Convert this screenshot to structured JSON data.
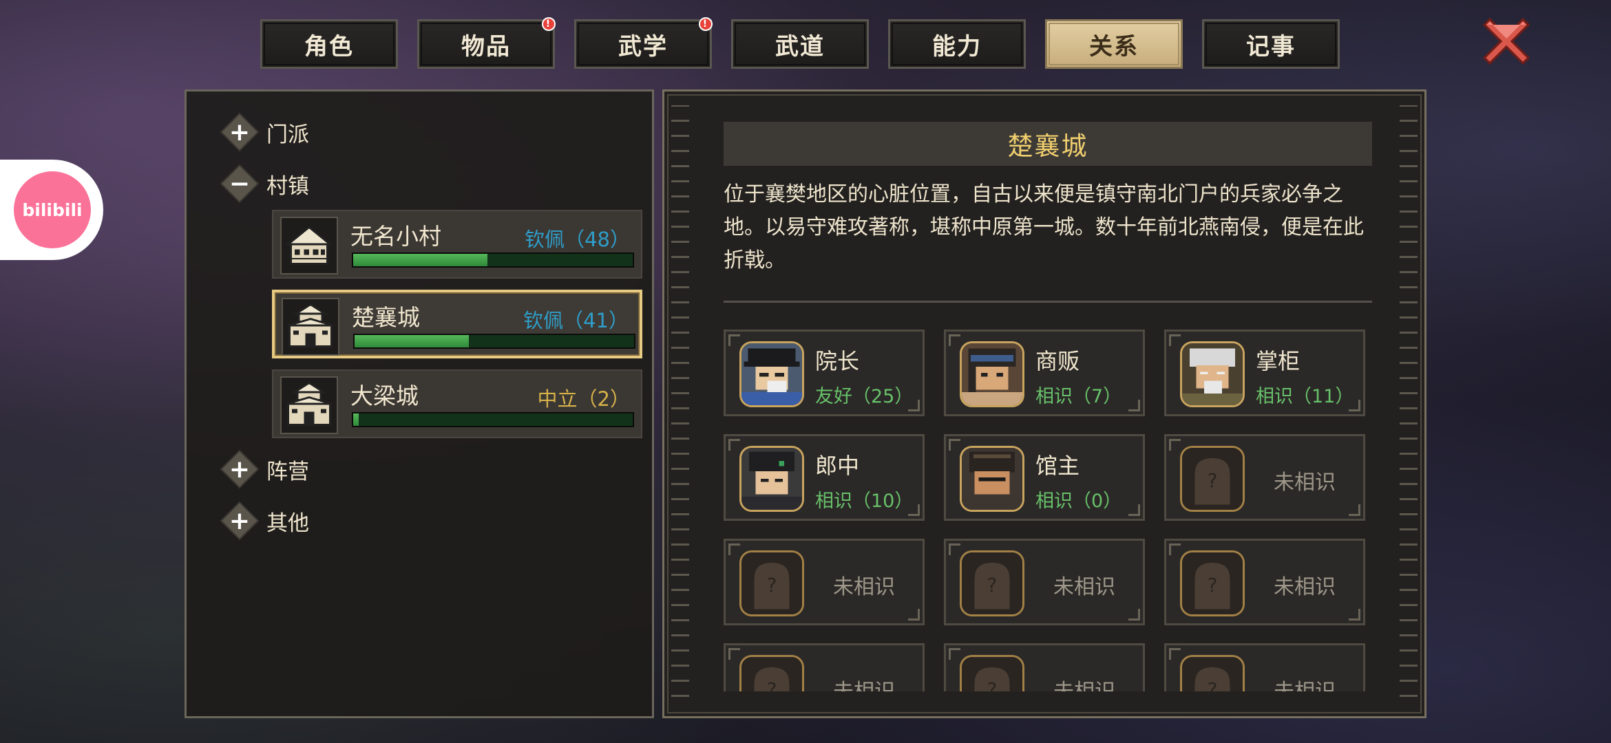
{
  "tabs": [
    {
      "label": "角色",
      "active": false,
      "alert": false
    },
    {
      "label": "物品",
      "active": false,
      "alert": true
    },
    {
      "label": "武学",
      "active": false,
      "alert": true
    },
    {
      "label": "武道",
      "active": false,
      "alert": false
    },
    {
      "label": "能力",
      "active": false,
      "alert": false
    },
    {
      "label": "关系",
      "active": true,
      "alert": false
    },
    {
      "label": "记事",
      "active": false,
      "alert": false
    }
  ],
  "alert_mark": "!",
  "bilibili_logo": "bilibili",
  "tree": {
    "menpai": {
      "label": "门派",
      "symbol": "+"
    },
    "cunzhen": {
      "label": "村镇",
      "symbol": "−"
    },
    "zhenying": {
      "label": "阵营",
      "symbol": "+"
    },
    "qita": {
      "label": "其他",
      "symbol": "+"
    }
  },
  "towns": [
    {
      "name": "无名小村",
      "status": "钦佩（48）",
      "status_color": "#2f9ec9",
      "progress": 0.48,
      "selected": false,
      "icon": "house-icon"
    },
    {
      "name": "楚襄城",
      "status": "钦佩（41）",
      "status_color": "#2f9ec9",
      "progress": 0.41,
      "selected": true,
      "icon": "city-gate-icon"
    },
    {
      "name": "大梁城",
      "status": "中立（2）",
      "status_color": "#d6b24a",
      "progress": 0.02,
      "selected": false,
      "icon": "city-gate-icon"
    }
  ],
  "detail": {
    "title": "楚襄城",
    "description": "位于襄樊地区的心脏位置，自古以来便是镇守南北门户的兵家必争之地。以易守难攻著称，堪称中原第一城。数十年前北燕南侵，便是在此折戟。"
  },
  "npcs": [
    {
      "name": "院长",
      "relation": "友好（25）",
      "known": true,
      "portrait": "dean-portrait"
    },
    {
      "name": "商贩",
      "relation": "相识（7）",
      "known": true,
      "portrait": "merchant-portrait"
    },
    {
      "name": "掌柜",
      "relation": "相识（11）",
      "known": true,
      "portrait": "shopkeeper-portrait"
    },
    {
      "name": "郎中",
      "relation": "相识（10）",
      "known": true,
      "portrait": "doctor-portrait"
    },
    {
      "name": "馆主",
      "relation": "相识（0）",
      "known": true,
      "portrait": "hall-master-portrait"
    },
    {
      "name": "",
      "relation": "未相识",
      "known": false
    },
    {
      "name": "",
      "relation": "未相识",
      "known": false
    },
    {
      "name": "",
      "relation": "未相识",
      "known": false
    },
    {
      "name": "",
      "relation": "未相识",
      "known": false
    },
    {
      "name": "",
      "relation": "未相识",
      "known": false
    },
    {
      "name": "",
      "relation": "未相识",
      "known": false
    },
    {
      "name": "",
      "relation": "未相识",
      "known": false
    }
  ],
  "colors": {
    "accent_gold": "#f0cf6e",
    "known_green": "#67c16a",
    "unknown_gray": "#9e978a"
  }
}
